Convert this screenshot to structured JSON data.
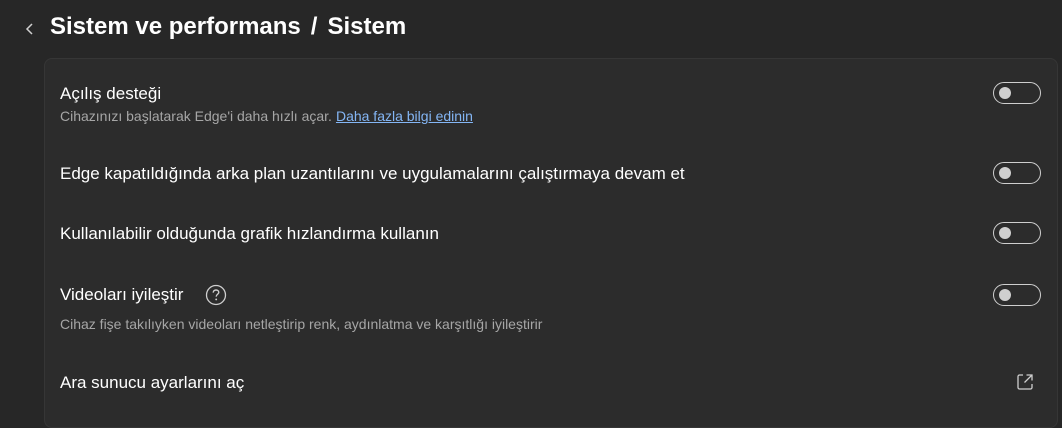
{
  "header": {
    "section": "Sistem ve performans",
    "separator": "/",
    "page": "Sistem",
    "back_icon": "chevron-left-icon"
  },
  "settings": {
    "startup_boost": {
      "title": "Açılış desteği",
      "description": "Cihazınızı başlatarak Edge'i daha hızlı açar.",
      "link": "Daha fazla bilgi edinin",
      "enabled": false
    },
    "background_apps": {
      "title": "Edge kapatıldığında arka plan uzantılarını ve uygulamalarını çalıştırmaya devam et",
      "enabled": false
    },
    "hardware_accel": {
      "title": "Kullanılabilir olduğunda grafik hızlandırma kullanın",
      "enabled": false
    },
    "video_enhance": {
      "title": "Videoları iyileştir",
      "description": "Cihaz fişe takılıyken videoları netleştirip renk, aydınlatma ve karşıtlığı iyileştirir",
      "help_icon": "question-circle-icon",
      "enabled": false
    },
    "proxy": {
      "title": "Ara sunucu ayarlarını aç",
      "icon": "external-link-icon"
    }
  },
  "colors": {
    "background": "#272727",
    "panel": "#2c2c2c",
    "link": "#84b6f5",
    "secondary_text": "#a6a6a6"
  }
}
